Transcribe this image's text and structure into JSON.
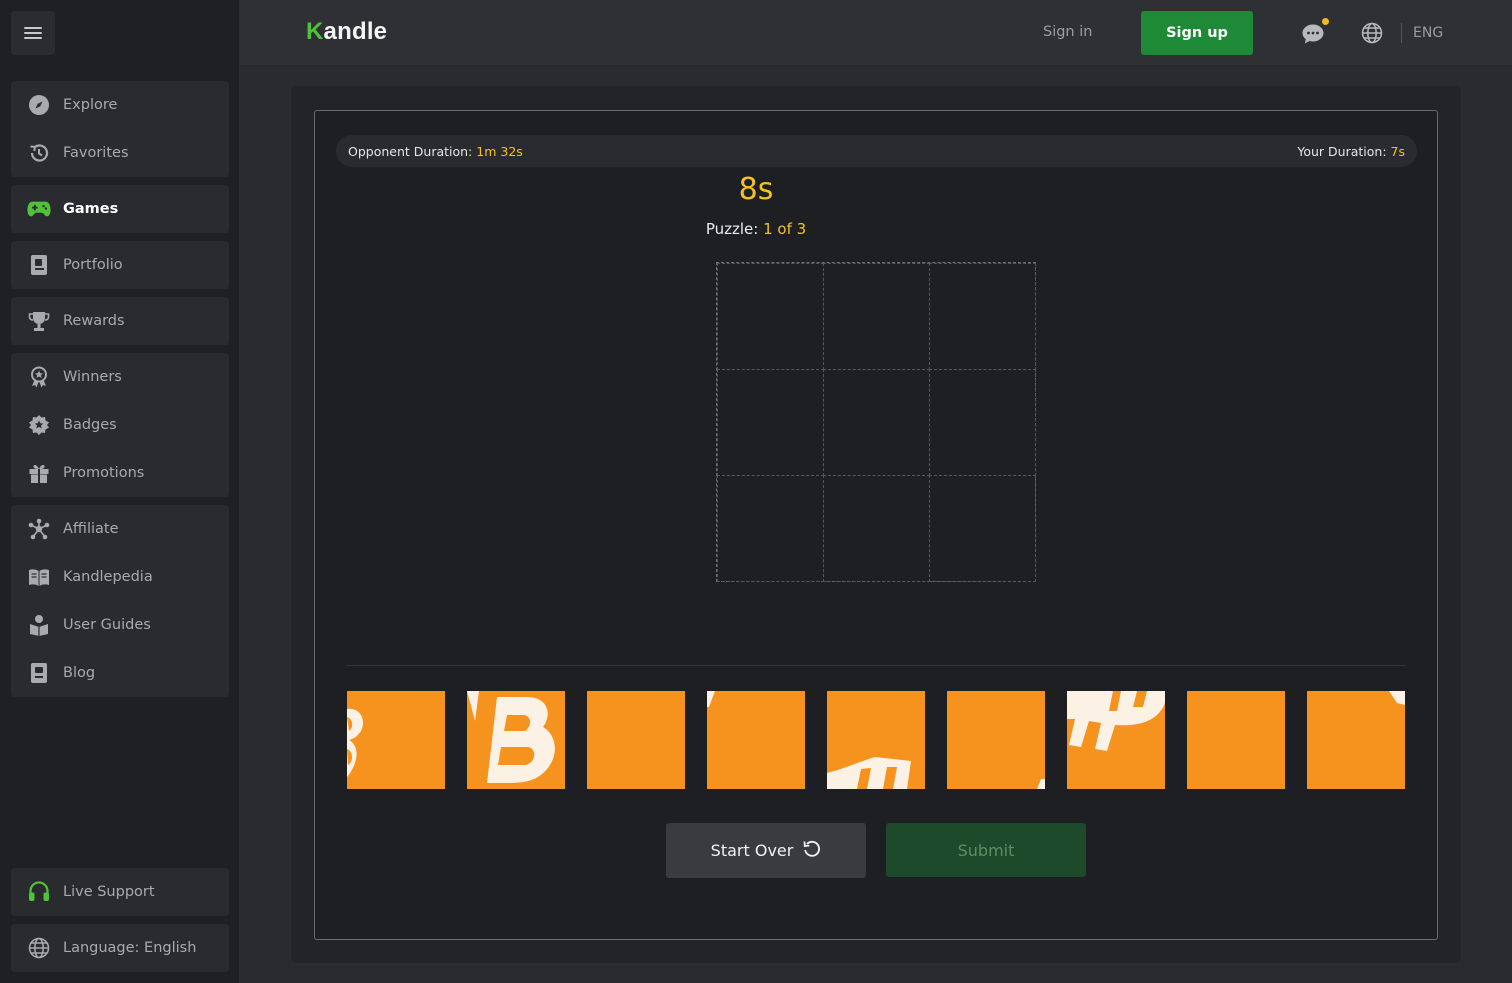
{
  "header": {
    "logo_k": "K",
    "logo_rest": "andle",
    "sign_in": "Sign in",
    "sign_up": "Sign up",
    "language_code": "ENG"
  },
  "sidebar": {
    "group1": [
      {
        "label": "Explore",
        "icon": "compass-icon"
      },
      {
        "label": "Favorites",
        "icon": "history-icon"
      }
    ],
    "group2": [
      {
        "label": "Games",
        "icon": "gamepad-icon",
        "active": true
      }
    ],
    "group3": [
      {
        "label": "Portfolio",
        "icon": "portfolio-icon"
      }
    ],
    "group4": [
      {
        "label": "Rewards",
        "icon": "trophy-icon"
      }
    ],
    "group5": [
      {
        "label": "Winners",
        "icon": "medal-icon"
      },
      {
        "label": "Badges",
        "icon": "badge-icon"
      },
      {
        "label": "Promotions",
        "icon": "gift-icon"
      }
    ],
    "group6": [
      {
        "label": "Affiliate",
        "icon": "network-icon"
      },
      {
        "label": "Kandlepedia",
        "icon": "book-icon"
      },
      {
        "label": "User Guides",
        "icon": "guide-icon"
      },
      {
        "label": "Blog",
        "icon": "blog-icon"
      }
    ],
    "live_support": "Live Support",
    "language": "Language: English"
  },
  "game": {
    "opponent_label": "Opponent Duration:",
    "opponent_value": "1m 32s",
    "your_label": "Your Duration:",
    "your_value": "7s",
    "timer": "8s",
    "puzzle_label": "Puzzle:",
    "puzzle_value": "1 of 3",
    "start_over": "Start Over",
    "submit": "Submit"
  },
  "colors": {
    "accent_green": "#1e8a38",
    "accent_yellow": "#f6c21c",
    "tile_orange": "#f6931e"
  }
}
